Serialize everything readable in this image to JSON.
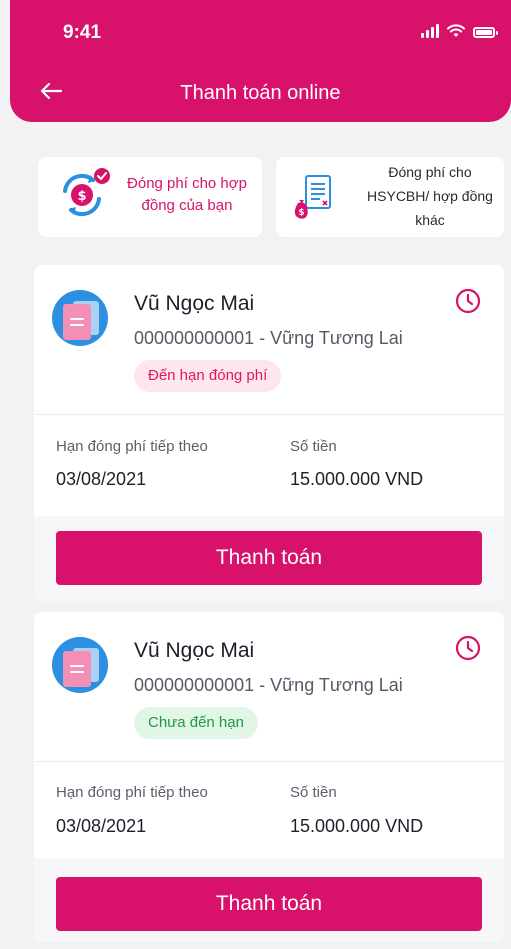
{
  "status_bar": {
    "time": "9:41"
  },
  "header": {
    "title": "Thanh toán online"
  },
  "quick_actions": [
    {
      "label": "Đóng phí cho hợp đồng của bạn",
      "icon": "dollar-cycle-icon"
    },
    {
      "label": "Đóng phí cho HSYCBH/ hợp đồng khác",
      "icon": "document-fee-icon"
    }
  ],
  "contracts": [
    {
      "name": "Vũ Ngọc Mai",
      "contract": "000000000001 - Vững Tương Lai",
      "status": "Đến hạn đóng phí",
      "due_label": "Hạn đóng phí tiếp theo",
      "due_date": "03/08/2021",
      "amount_label": "Số tiền",
      "amount": "15.000.000 VND",
      "button": "Thanh toán"
    },
    {
      "name": "Vũ Ngọc Mai",
      "contract": "000000000001 - Vững Tương Lai",
      "status": "Chưa đến hạn",
      "due_label": "Hạn đóng phí tiếp theo",
      "due_date": "03/08/2021",
      "amount_label": "Số tiền",
      "amount": "15.000.000 VND",
      "button": "Thanh toán"
    }
  ],
  "colors": {
    "brand": "#d8126b",
    "due_badge_bg": "#fde7ec",
    "due_badge_text": "#e2165b",
    "notdue_badge_bg": "#e1f6e6",
    "notdue_badge_text": "#1f9a41"
  }
}
